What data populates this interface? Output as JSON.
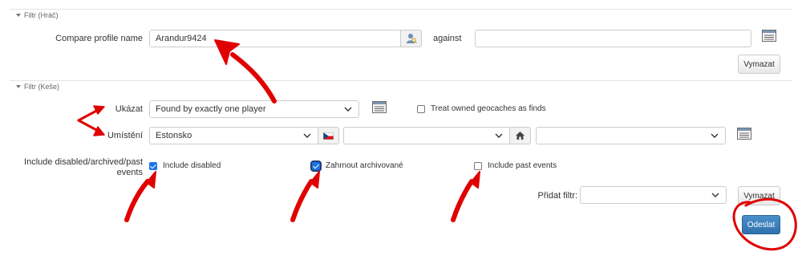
{
  "player_filter": {
    "title": "Filtr (Hráč)",
    "compare_label": "Compare profile name",
    "compare_value": "Arandur9424",
    "against_label": "against",
    "against_value": "",
    "clear_label": "Vymazat"
  },
  "cache_filter": {
    "title": "Filtr (Keše)",
    "show_label": "Ukázat",
    "show_value": "Found by exactly one player",
    "treat_owned_label": "Treat owned geocaches as finds",
    "location_label": "Umístění",
    "location_country": "Estonsko",
    "location_region": "",
    "location_district": "",
    "include_label": "Include disabled/archived/past events",
    "include_disabled_label": "Include disabled",
    "include_archived_label": "Zahrnout archivované",
    "include_past_label": "Include past events",
    "add_filter_label": "Přidat filtr:",
    "add_filter_value": "",
    "clear_label": "Vymazat",
    "submit_label": "Odeslat"
  },
  "checkbox_state": {
    "include_disabled": true,
    "include_archived": true,
    "include_past": false,
    "treat_owned": false
  },
  "icons": {
    "user_lookup": "user-search-icon",
    "table": "table-list-icon",
    "flag": "czech-flag-icon",
    "home": "home-icon",
    "chevron": "chevron-down-icon"
  },
  "colors": {
    "primary": "#2f70ad",
    "checkbox": "#1a73e8",
    "annotation": "#e00000"
  }
}
